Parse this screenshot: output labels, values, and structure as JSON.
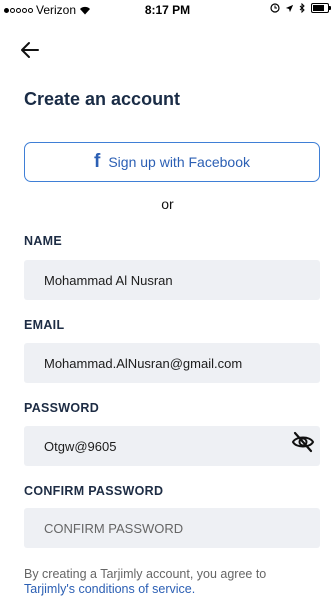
{
  "status_bar": {
    "carrier": "Verizon",
    "time": "8:17 PM"
  },
  "header": {
    "title": "Create an account"
  },
  "facebook_button": {
    "icon": "f",
    "label": "Sign up with Facebook"
  },
  "divider_text": "or",
  "form": {
    "name": {
      "label": "NAME",
      "value": "Mohammad Al Nusran"
    },
    "email": {
      "label": "EMAIL",
      "value": "Mohammad.AlNusran@gmail.com"
    },
    "password": {
      "label": "PASSWORD",
      "value": "Otgw@9605"
    },
    "confirm_password": {
      "label": "CONFIRM PASSWORD",
      "placeholder": "CONFIRM PASSWORD"
    }
  },
  "terms": {
    "prefix": "By creating a Tarjimly account, you agree to",
    "link": "Tarjimly's conditions of service."
  }
}
